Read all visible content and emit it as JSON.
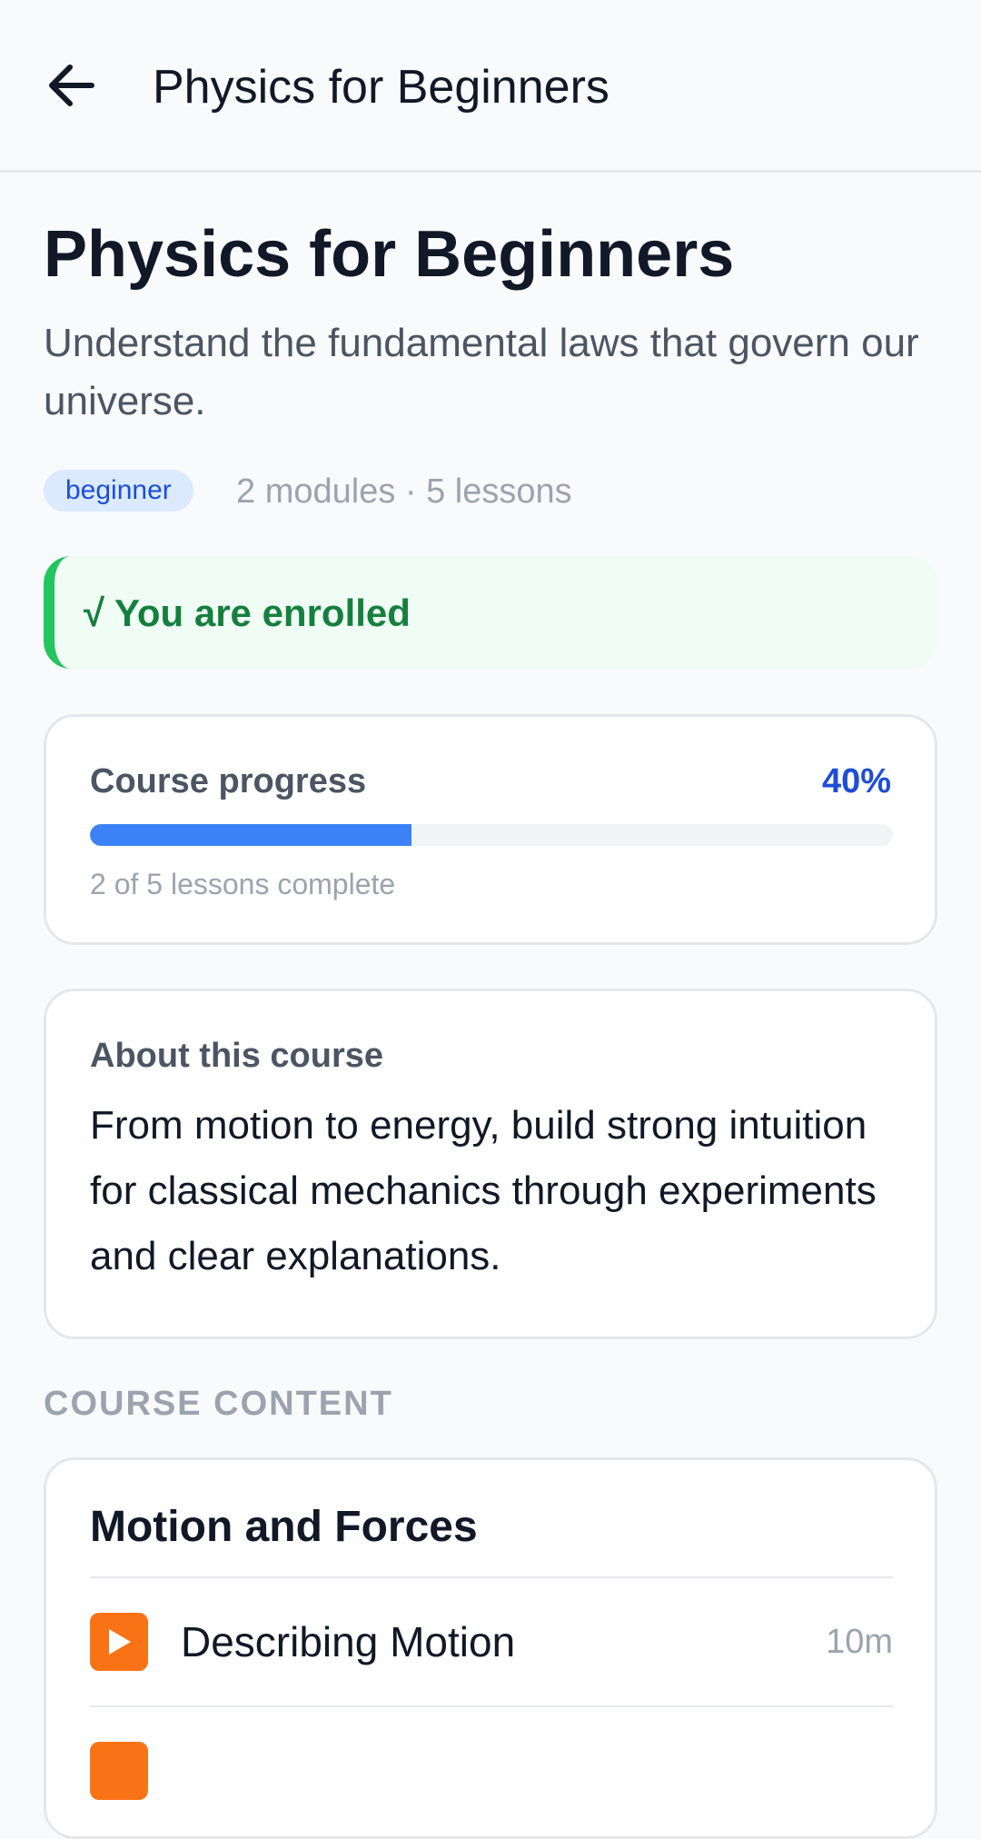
{
  "app_bar": {
    "title": "Physics for Beginners"
  },
  "course": {
    "title": "Physics for Beginners",
    "subtitle": "Understand the fundamental laws that govern our universe.",
    "level": "beginner",
    "meta": "2 modules · 5 lessons"
  },
  "enrollment": {
    "status": "√ You are enrolled"
  },
  "progress": {
    "label": "Course progress",
    "percent_text": "40%",
    "fraction": 0.4,
    "caption": "2 of 5 lessons complete"
  },
  "about": {
    "heading": "About this course",
    "body": "From motion to energy, build strong intuition for classical mechanics through experiments and clear explanations."
  },
  "content": {
    "section_label": "COURSE CONTENT",
    "modules": [
      {
        "title": "Motion and Forces",
        "lessons": [
          {
            "title": "Describing Motion",
            "duration": "10m",
            "icon": "play-icon"
          }
        ]
      }
    ]
  },
  "colors": {
    "accent": "#3b82f6",
    "accent_text": "#1d4ed8",
    "success": "#15803d",
    "success_bar": "#22c55e",
    "play_icon": "#f97316"
  }
}
